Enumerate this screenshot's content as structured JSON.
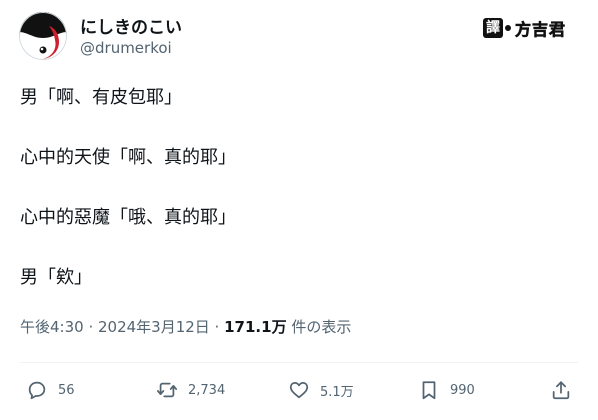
{
  "user": {
    "display_name": "にしきのこい",
    "handle": "@drumerkoi",
    "avatar_icon": "koi-fish-avatar"
  },
  "watermark": {
    "label": "譯",
    "name": "方吉君"
  },
  "tweet": {
    "lines": [
      "男「啊、有皮包耶」",
      "心中的天使「啊、真的耶」",
      "心中的惡魔「哦、真的耶」",
      "男「欸」"
    ]
  },
  "meta": {
    "timestamp": "午後4:30 · 2024年3月12日 ·",
    "views": "171.1万",
    "views_suffix": "件の表示"
  },
  "actions": {
    "reply_count": "56",
    "retweet_count": "2,734",
    "like_count": "5.1万",
    "bookmark_count": "990"
  }
}
